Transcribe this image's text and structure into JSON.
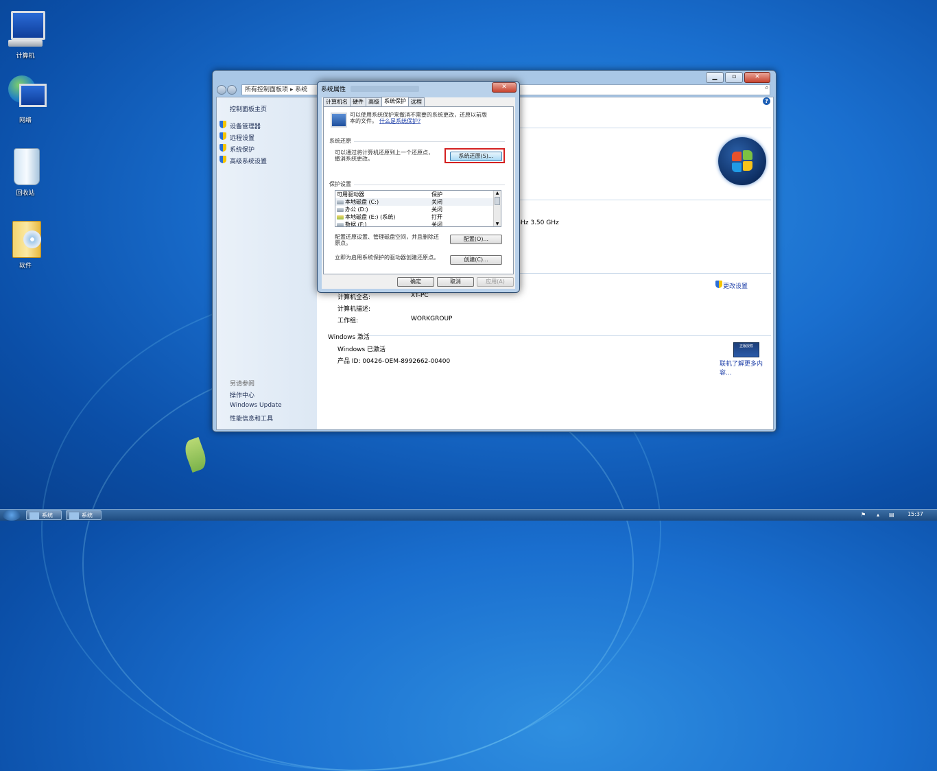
{
  "desktop": {
    "icons": [
      {
        "label": "计算机",
        "icon": "computer-icon"
      },
      {
        "label": "网络",
        "icon": "network-icon"
      },
      {
        "label": "回收站",
        "icon": "recycle-bin-icon"
      },
      {
        "label": "软件",
        "icon": "folder-icon"
      }
    ]
  },
  "main_window": {
    "address": "所有控制面板项 ▸ 系统",
    "sidebar": {
      "home": "控制面板主页",
      "links": [
        "设备管理器",
        "远程设置",
        "系统保护",
        "高级系统设置"
      ],
      "see_also_title": "另请参阅",
      "see_also": [
        "操作中心",
        "Windows Update",
        "性能信息和工具"
      ]
    },
    "processor_fragment": "GHz   3.50 GHz",
    "computer_fullname_label": "计算机全名:",
    "computer_fullname_value": "XT-PC",
    "computer_desc_label": "计算机描述:",
    "workgroup_label": "工作组:",
    "workgroup_value": "WORKGROUP",
    "change_settings": "更改设置",
    "activation_title": "Windows 激活",
    "activation_status": "Windows 已激活",
    "product_id": "产品 ID: 00426-OEM-8992662-00400",
    "genuine_link": "联机了解更多内容...",
    "genuine_badge": "正版授权"
  },
  "dialog": {
    "title": "系统属性",
    "tabs": [
      "计算机名",
      "硬件",
      "高级",
      "系统保护",
      "远程"
    ],
    "active_tab": "系统保护",
    "intro_text_1": "可以使用系统保护来撤消不需要的系统更改，还原以前版",
    "intro_text_2": "本的文件。",
    "intro_link": "什么是系统保护?",
    "restore_group": "系统还原",
    "restore_text_1": "可以通过将计算机还原到上一个还原点，",
    "restore_text_2": "撤消系统更改。",
    "restore_button": "系统还原(S)...",
    "protection_group": "保护设置",
    "list_headers": [
      "可用驱动器",
      "保护"
    ],
    "drives": [
      {
        "name": "本地磁盘 (C:)",
        "status": "关闭"
      },
      {
        "name": "办公 (D:)",
        "status": "关闭"
      },
      {
        "name": "本地磁盘 (E:) (系统)",
        "status": "打开"
      },
      {
        "name": "数据 (F:)",
        "status": "关闭"
      }
    ],
    "config_text_1": "配置还原设置、管理磁盘空间，并且删除还",
    "config_text_2": "原点。",
    "config_button": "配置(O)...",
    "create_text": "立即为启用系统保护的驱动器创建还原点。",
    "create_button": "创建(C)...",
    "ok": "确定",
    "cancel": "取消",
    "apply": "应用(A)"
  },
  "taskbar": {
    "items": [
      "系统",
      "系统"
    ],
    "clock": "15:37"
  },
  "colors": {
    "desktop": "#1a6fcf",
    "highlight": "#d42020",
    "link": "#1e3fa8"
  }
}
